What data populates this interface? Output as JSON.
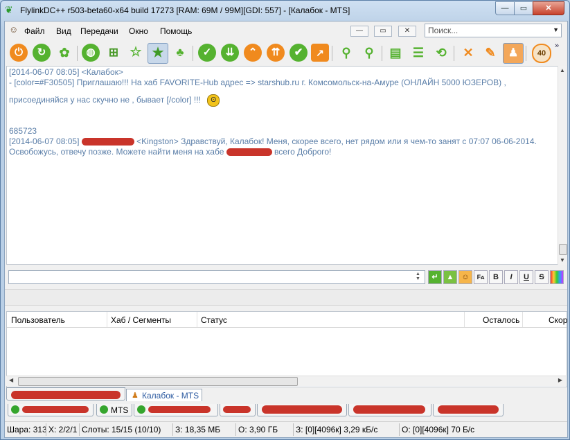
{
  "window": {
    "title": "FlylinkDC++ r503-beta60-x64 build 17273 [RAM: 69M / 99M][GDI: 557] - [Калабок - MTS]",
    "minimize": "—",
    "maximize": "▭",
    "close": "✕"
  },
  "menu": {
    "items": [
      "Файл",
      "Вид",
      "Передачи",
      "Окно",
      "Помощь"
    ],
    "mdi": [
      "—",
      "▭",
      "✕"
    ],
    "search": {
      "placeholder": "Поиск..."
    }
  },
  "toolbar": {
    "icons": [
      "power-icon",
      "refresh-icon",
      "users-network-icon",
      "globe-icon",
      "network-icon",
      "favorite-outline-icon",
      "favorite-star-icon",
      "favorite-users-icon",
      "check-down-icon",
      "download-icon",
      "arrow-up-icon",
      "upload-icon",
      "check-icon",
      "chart-icon",
      "search-icon",
      "search-advanced-icon",
      "database-icon",
      "database-stack-icon",
      "database-refresh-icon",
      "tools-icon",
      "edit-icon",
      "away-icon",
      "limiter-icon"
    ],
    "limiter_value": "40",
    "overflow": "»"
  },
  "chat": {
    "lines": [
      {
        "text": "[2014-06-07 08:05] <Калабок>"
      },
      {
        "text": "- [color=#F30505] Приглашаю!!! На хаб FAVORITE-Hub адрес =>  starshub.ru  г. Комсомольск-на-Амуре (ОНЛАЙН 5000 ЮЗЕРОВ) ,"
      },
      {
        "text": "присоединяйся у нас скучно не , бывает [/color] !!!"
      },
      {
        "text": "685723"
      },
      {
        "prefix": "[2014-06-07 08:05] ",
        "suffix": " <Kingston> Здравствуй, Калабок! Меня, скорее всего, нет рядом или я чем-то занят с 07:07 06-06-2014."
      },
      {
        "prefix": "Освобожусь, отвечу позже. Можете найти меня на хабе ",
        "suffix": " всего Доброго!"
      }
    ]
  },
  "input": {
    "value": ""
  },
  "format_buttons": [
    "B",
    "I",
    "U",
    "S"
  ],
  "transfers": {
    "columns": [
      "Пользователь",
      "Хаб / Сегменты",
      "Статус",
      "Осталось",
      "Скор"
    ]
  },
  "tabs": {
    "active": "Калабок - MTS",
    "hub_tabs": [
      "MTS"
    ]
  },
  "status": {
    "share": "Шара: 313",
    "x": "X: 2/2/1",
    "slots": "Слоты: 15/15 (10/10)",
    "z1": "З: 18,35 МБ",
    "o1": "О: 3,90 ГБ",
    "z2": "З: [0][4096к] 3,29 кБ/с",
    "o2": "О: [0][4096к] 70 Б/с"
  },
  "colors": {
    "chat_text": "#5a7ea8",
    "toolbar_orange": "#f08a1e",
    "toolbar_green": "#55b230",
    "redaction": "#c9342a"
  }
}
